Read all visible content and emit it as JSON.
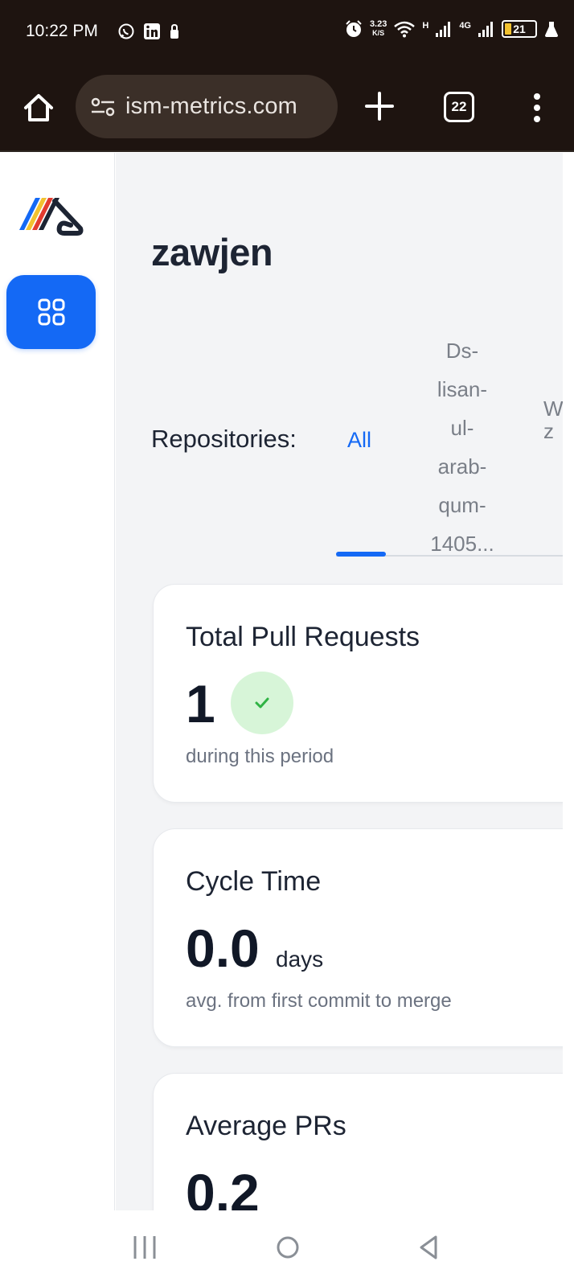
{
  "status_bar": {
    "time": "10:22 PM",
    "net_speed_value": "3.23",
    "net_speed_unit": "K/S",
    "signal1_label": "H",
    "signal2_label": "4G",
    "battery": "21",
    "icons": [
      "whatsapp-icon",
      "linkedin-icon",
      "lock-icon",
      "alarm-icon",
      "wifi-icon",
      "signal-icon",
      "signal-icon",
      "battery-icon",
      "flask-icon"
    ]
  },
  "browser": {
    "url": "ism-metrics.com",
    "tab_count": "22",
    "icons": [
      "home-icon",
      "site-settings-icon",
      "plus-icon",
      "tabs-icon",
      "more-vert-icon"
    ]
  },
  "sidebar": {
    "items": [
      {
        "icon": "dashboard-grid-icon",
        "active": true
      }
    ]
  },
  "main": {
    "org_name": "zawjen",
    "repo_filter": {
      "label": "Repositories:",
      "tabs": [
        {
          "label": "All",
          "active": true
        },
        {
          "label": "Ds-lisan-ul-arab-qum-1405...",
          "lines": [
            "Ds-",
            "lisan-",
            "ul-",
            "arab-",
            "qum-",
            "1405..."
          ],
          "active": false
        },
        {
          "label": "W z",
          "lines": [
            "W",
            "z"
          ],
          "active": false
        }
      ]
    },
    "cards": [
      {
        "title": "Total Pull Requests",
        "value": "1",
        "subtitle": "during this period",
        "badge_icon": "check-icon"
      },
      {
        "title": "Cycle Time",
        "value": "0.0",
        "unit": "days",
        "subtitle": "avg. from first commit to merge"
      },
      {
        "title": "Average PRs",
        "value": "0.2"
      }
    ]
  },
  "colors": {
    "accent": "#1469f5",
    "status_bar_bg": "#1e1410",
    "main_bg": "#f3f4f6",
    "success_bg": "#d7f5d8",
    "success": "#2fb344"
  },
  "nav_bar": {
    "icons": [
      "recent-apps-icon",
      "home-circle-icon",
      "back-icon"
    ]
  }
}
